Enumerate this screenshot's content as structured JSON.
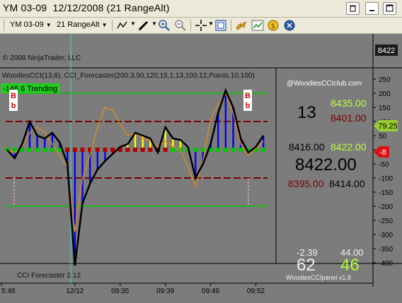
{
  "window": {
    "title": "YM 03-09  12/12/2008 (21 RangeAlt)"
  },
  "toolbar": {
    "instrument": "YM 03-09",
    "period": "21 RangeAlt"
  },
  "chart": {
    "copyright": "© 2008 NinjaTrader, LLC",
    "indicator_line": "WoodiesCCI(13,8), CCI_Forecaster(200,3,50,120,15,1,13,100,12,Points,10,100)",
    "trending_label": "-146.6 Trending",
    "watermark": "@WoodiesCCIclub.com",
    "price_marker": "8422",
    "cci_marker": "79.25",
    "turbo_marker": "-8",
    "forecaster_label": "CCI Forecaster 2.12",
    "signal_letter": "b",
    "side_letter": "B",
    "colors": {
      "cci": "#000000",
      "turbo": "#e08a1e",
      "lime": "#00c800",
      "red": "#b00000",
      "dark_red": "#7a0000",
      "yellow": "#ffff00",
      "blue": "#0000ff",
      "cyan": "#55d6d6"
    },
    "y_axis_labels": [
      "250",
      "200",
      "150",
      "100",
      "50",
      "0",
      "-50",
      "-100",
      "-150",
      "-200",
      "-250",
      "-300",
      "-350",
      "-400"
    ],
    "x_axis_labels": [
      "5:48",
      "12/12",
      "09:35",
      "09:39",
      "09:46",
      "09:52"
    ],
    "chart_data": {
      "type": "line",
      "title": "",
      "ylim": [
        -410,
        260
      ],
      "series": [
        {
          "name": "",
          "color": "#000000",
          "values": [
            0,
            -30,
            20,
            100,
            50,
            40,
            60,
            25,
            -50,
            -410,
            -190,
            -120,
            -70,
            -40,
            -15,
            10,
            20,
            60,
            50,
            40,
            -10,
            80,
            40,
            35,
            10,
            -100,
            -50,
            20,
            130,
            210,
            150,
            40,
            -10,
            10,
            50
          ]
        },
        {
          "name": "",
          "color": "#e08a1e",
          "values": [
            0,
            -10,
            10,
            60,
            80,
            60,
            20,
            -20,
            -60,
            -290,
            -100,
            -20,
            80,
            150,
            140,
            90,
            50,
            60,
            40,
            30,
            10,
            30,
            10,
            0,
            -60,
            -130,
            -40,
            110,
            160,
            200,
            130,
            20,
            -20,
            5,
            30
          ]
        }
      ]
    },
    "panel": {
      "value_13": "13",
      "top_green": "8435.00",
      "top_red": "8401.00",
      "mid_black": "8416.00",
      "mid_green": "8422.00",
      "big_price": "8422.00",
      "low_red": "8395.00",
      "low_black": "8414.00",
      "stat_neg": "-2.39",
      "stat_44": "44.00",
      "stat_62": "62",
      "stat_46": "46",
      "panel_credit": "WoodiesCCIpanel v1.8"
    }
  }
}
